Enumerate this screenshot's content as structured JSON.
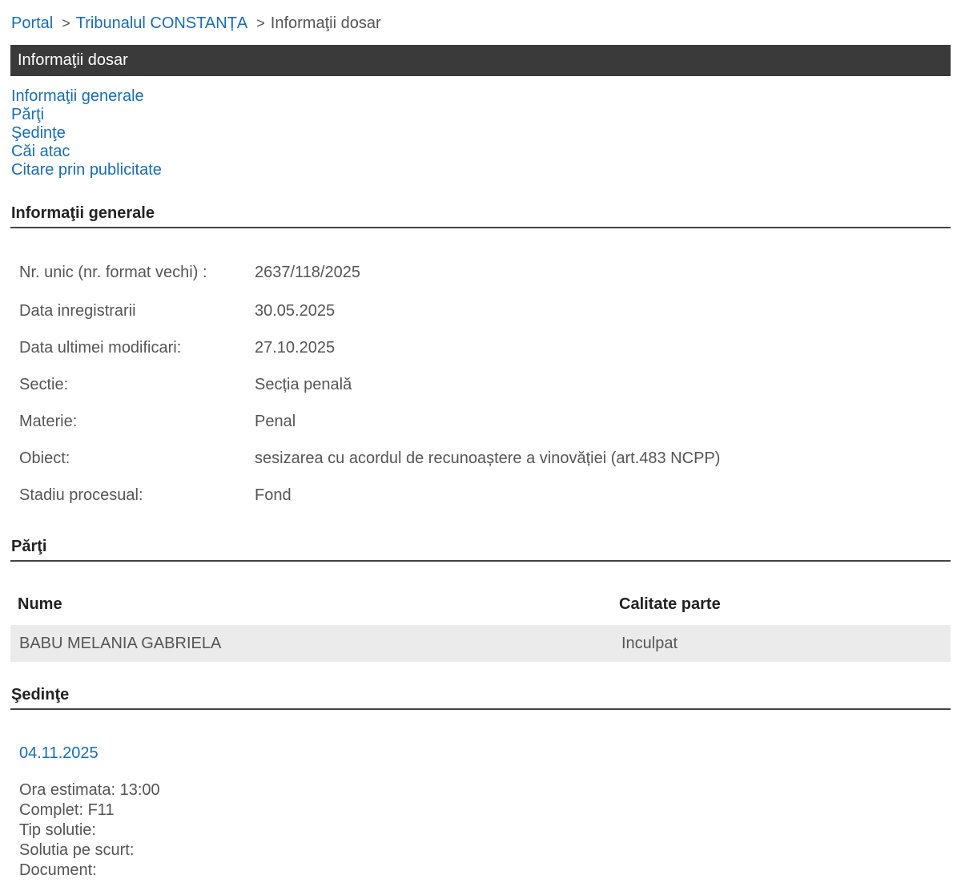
{
  "breadcrumb": {
    "portal": "Portal",
    "separator": ">",
    "court": "Tribunalul CONSTANȚA",
    "current": "Informaţii dosar"
  },
  "title_bar": "Informaţii dosar",
  "anchor_nav": [
    "Informaţii generale",
    "Părţi",
    "Şedinţe",
    "Căi atac",
    "Citare prin publicitate"
  ],
  "general": {
    "header": "Informaţii generale",
    "rows": [
      {
        "label": "Nr. unic (nr. format vechi) :",
        "value": "2637/118/2025"
      },
      {
        "label": "Data inregistrarii",
        "value": "30.05.2025"
      },
      {
        "label": "Data ultimei modificari:",
        "value": "27.10.2025"
      },
      {
        "label": "Sectie:",
        "value": "Secția penală"
      },
      {
        "label": "Materie:",
        "value": "Penal"
      },
      {
        "label": "Obiect:",
        "value": "sesizarea cu acordul de recunoaștere a vinovăției (art.483 NCPP)"
      },
      {
        "label": "Stadiu procesual:",
        "value": "Fond"
      }
    ]
  },
  "parti": {
    "header": "Părţi",
    "columns": [
      "Nume",
      "Calitate parte"
    ],
    "rows": [
      {
        "nume": "BABU MELANIA GABRIELA",
        "calitate": "Inculpat"
      }
    ]
  },
  "sedinte": {
    "header": "Şedinţe",
    "date": "04.11.2025",
    "details": [
      "Ora estimata: 13:00",
      "Complet: F11",
      "Tip solutie:",
      "Solutia pe scurt:",
      "Document:"
    ]
  }
}
